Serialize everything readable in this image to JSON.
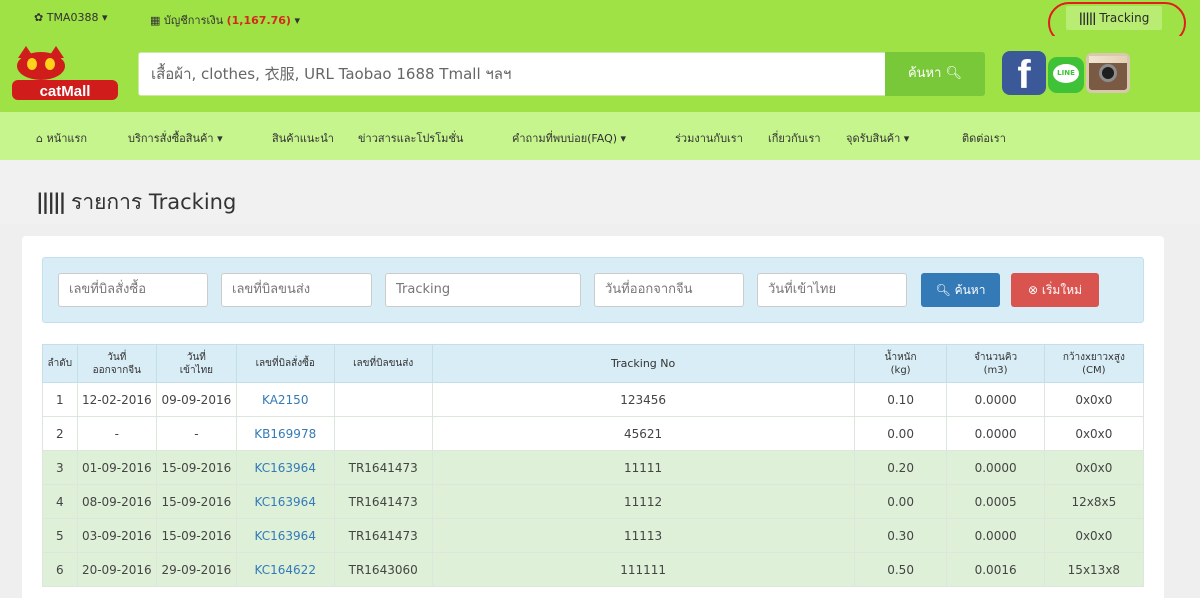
{
  "topbar": {
    "account": "TMA0388",
    "wallet_label": "บัญชีการเงิน",
    "wallet_amount": "(1,167.76)",
    "tracking_button": "Tracking"
  },
  "header": {
    "logo_text": "catMall",
    "search_placeholder": "เสื้อผ้า, clothes, 衣服, URL Taobao 1688 Tmall ฯลฯ",
    "search_button": "ค้นหา",
    "social": [
      "facebook-icon",
      "line-icon",
      "instagram-icon"
    ],
    "line_label": "LINE"
  },
  "nav": {
    "items": [
      {
        "label": "หน้าแรก",
        "dropdown": false
      },
      {
        "label": "บริการสั่งซื้อสินค้า",
        "dropdown": true
      },
      {
        "label": "สินค้าแนะนำ",
        "dropdown": false
      },
      {
        "label": "ข่าวสารและโปรโมชั่น",
        "dropdown": false
      },
      {
        "label": "คำถามที่พบบ่อย(FAQ)",
        "dropdown": true
      },
      {
        "label": "ร่วมงานกับเรา",
        "dropdown": false
      },
      {
        "label": "เกี่ยวกับเรา",
        "dropdown": false
      },
      {
        "label": "จุดรับสินค้า",
        "dropdown": true
      },
      {
        "label": "ติดต่อเรา",
        "dropdown": false
      }
    ]
  },
  "page": {
    "title": "รายการ Tracking"
  },
  "filter": {
    "order_no_placeholder": "เลขที่บิลสั่งซื้อ",
    "shipping_no_placeholder": "เลขที่บิลขนส่ง",
    "tracking_placeholder": "Tracking",
    "leave_china_placeholder": "วันที่ออกจากจีน",
    "arrive_thai_placeholder": "วันที่เข้าไทย",
    "search_button": "ค้นหา",
    "reset_button": "เริ่มใหม่"
  },
  "table": {
    "headers": {
      "seq": "ลำดับ",
      "leave_china_1": "วันที่",
      "leave_china_2": "ออกจากจีน",
      "arrive_thai_1": "วันที่",
      "arrive_thai_2": "เข้าไทย",
      "order_no": "เลขที่บิลสั่งซื้อ",
      "shipping_no": "เลขที่บิลขนส่ง",
      "tracking_no": "Tracking No",
      "weight_1": "น้ำหนัก",
      "weight_2": "(kg)",
      "volume_1": "จำนวนคิว",
      "volume_2": "(m3)",
      "dims_1": "กว้างxยาวxสูง",
      "dims_2": "(CM)"
    },
    "rows": [
      {
        "seq": "1",
        "leave_china": "12-02-2016",
        "arrive_thai": "09-09-2016",
        "order_no": "KA2150",
        "shipping_no": "",
        "tracking_no": "123456",
        "weight": "0.10",
        "volume": "0.0000",
        "dims": "0x0x0",
        "highlight": false
      },
      {
        "seq": "2",
        "leave_china": "-",
        "arrive_thai": "-",
        "order_no": "KB169978",
        "shipping_no": "",
        "tracking_no": "45621",
        "weight": "0.00",
        "volume": "0.0000",
        "dims": "0x0x0",
        "highlight": false
      },
      {
        "seq": "3",
        "leave_china": "01-09-2016",
        "arrive_thai": "15-09-2016",
        "order_no": "KC163964",
        "shipping_no": "TR1641473",
        "tracking_no": "11111",
        "weight": "0.20",
        "volume": "0.0000",
        "dims": "0x0x0",
        "highlight": true
      },
      {
        "seq": "4",
        "leave_china": "08-09-2016",
        "arrive_thai": "15-09-2016",
        "order_no": "KC163964",
        "shipping_no": "TR1641473",
        "tracking_no": "11112",
        "weight": "0.00",
        "volume": "0.0005",
        "dims": "12x8x5",
        "highlight": true
      },
      {
        "seq": "5",
        "leave_china": "03-09-2016",
        "arrive_thai": "15-09-2016",
        "order_no": "KC163964",
        "shipping_no": "TR1641473",
        "tracking_no": "11113",
        "weight": "0.30",
        "volume": "0.0000",
        "dims": "0x0x0",
        "highlight": true
      },
      {
        "seq": "6",
        "leave_china": "20-09-2016",
        "arrive_thai": "29-09-2016",
        "order_no": "KC164622",
        "shipping_no": "TR1643060",
        "tracking_no": "111111",
        "weight": "0.50",
        "volume": "0.0016",
        "dims": "15x13x8",
        "highlight": true
      }
    ]
  },
  "colors": {
    "brand_green": "#9ee246",
    "nav_green": "#c5f58c",
    "primary_blue": "#337ab7",
    "danger_red": "#d9534f",
    "highlight_ring": "#e11d1d",
    "wallet_amount": "#d32a1c"
  }
}
